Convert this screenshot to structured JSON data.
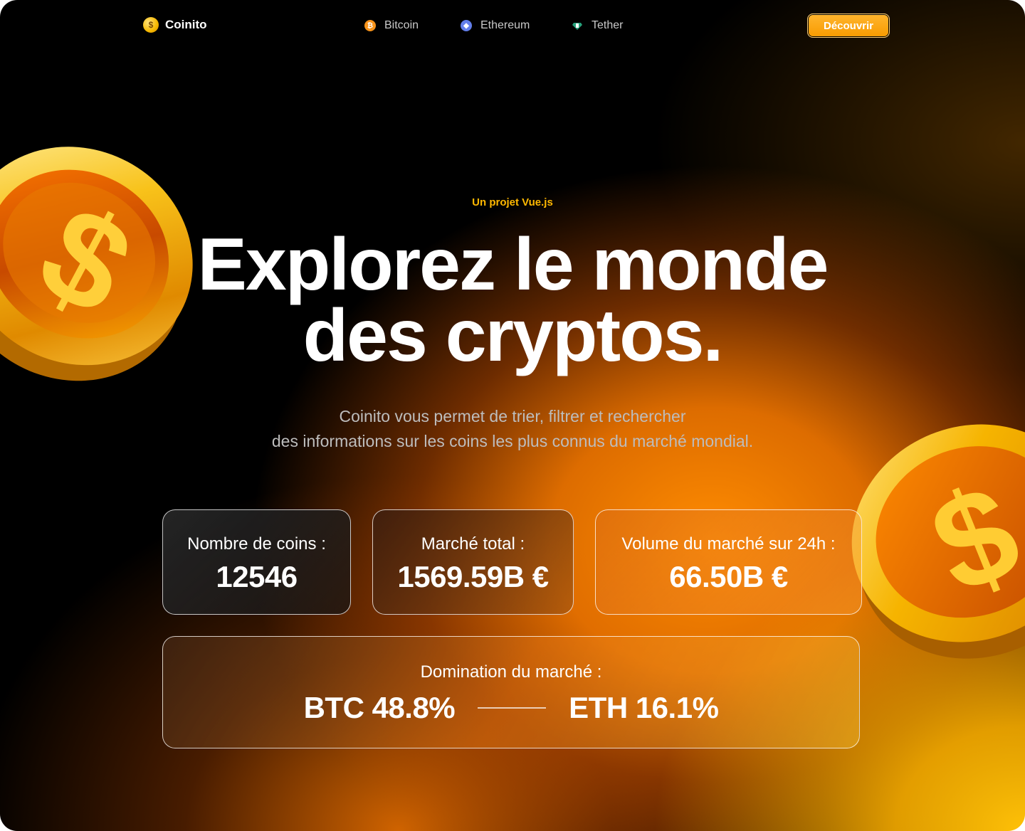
{
  "nav": {
    "brand": "Coinito",
    "links": [
      {
        "label": "Bitcoin",
        "icon": "bitcoin-icon"
      },
      {
        "label": "Ethereum",
        "icon": "ethereum-icon"
      },
      {
        "label": "Tether",
        "icon": "tether-icon"
      }
    ],
    "cta": "Découvrir"
  },
  "hero": {
    "kicker": "Un projet Vue.js",
    "title_line1": "Explorez le monde",
    "title_line2": "des cryptos.",
    "subtitle_line1": "Coinito vous permet de trier, filtrer et rechercher",
    "subtitle_line2": "des informations sur les coins les plus connus du marché mondial."
  },
  "stats": {
    "coins_label": "Nombre de coins :",
    "coins_value": "12546",
    "market_label": "Marché total :",
    "market_value": "1569.59B €",
    "volume_label": "Volume du marché sur 24h :",
    "volume_value": "66.50B €",
    "dominance_label": "Domination du marché :",
    "btc_dominance": "BTC 48.8%",
    "eth_dominance": "ETH 16.1%"
  },
  "colors": {
    "accent": "#f89b00",
    "kicker": "#ffb800",
    "background": "#000000",
    "gold": "#f5b800"
  }
}
